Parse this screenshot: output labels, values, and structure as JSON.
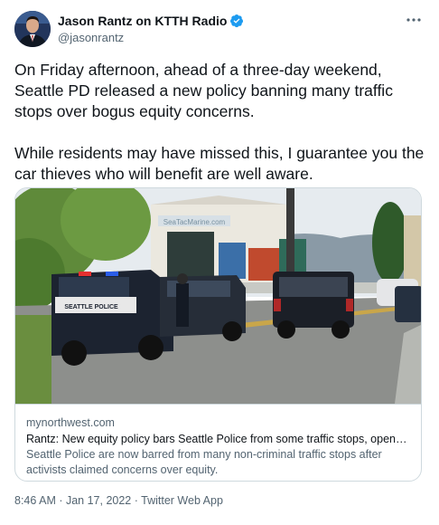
{
  "author": {
    "display_name": "Jason Rantz on KTTH Radio",
    "handle": "@jasonrantz"
  },
  "icons": {
    "verified": "verified-badge-icon",
    "more": "more-options-icon"
  },
  "tweet": {
    "paragraph_1": "On Friday afternoon, ahead of a three-day weekend, Seattle PD released a new policy banning many traffic stops over bogus equity concerns.",
    "paragraph_2": "While residents may have missed this, I guarantee you the car thieves who will benefit are well aware."
  },
  "card": {
    "domain": "mynorthwest.com",
    "title": "Rantz: New equity policy bars Seattle Police from some traffic stops, opens door for ...",
    "description": "Seattle Police are now barred from many non-criminal traffic stops after activists claimed concerns over equity.",
    "image_sign": "SeaTacMarine.com",
    "car_label": "SEATTLE POLICE"
  },
  "meta": {
    "timestamp": "8:46 AM · Jan 17, 2022 · Twitter Web App"
  },
  "colors": {
    "text": "#0f1419",
    "secondary": "#536471",
    "border": "#cfd9de",
    "verified": "#1d9bf0"
  }
}
